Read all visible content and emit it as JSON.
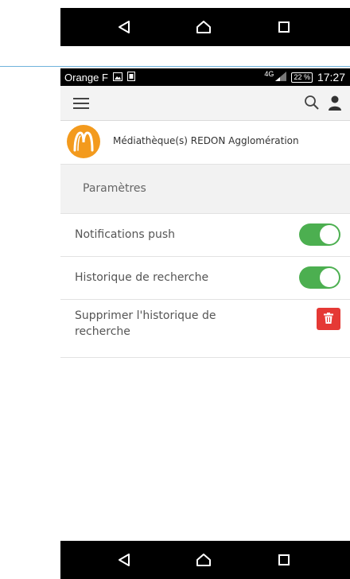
{
  "statusbar": {
    "carrier": "Orange F",
    "network": "4G",
    "battery": "22 %",
    "time": "17:27"
  },
  "library": {
    "name": "Médiathèque(s) REDON Agglomération"
  },
  "section": {
    "title": "Paramètres"
  },
  "settings": [
    {
      "label": "Notifications push",
      "enabled": true
    },
    {
      "label": "Historique de recherche",
      "enabled": true
    },
    {
      "label": "Supprimer l'historique de recherche"
    }
  ],
  "colors": {
    "toggle_on": "#4caf50",
    "delete_button": "#e53935",
    "logo": "#f39a1d"
  },
  "icons": {
    "menu": "hamburger-icon",
    "search": "search-icon",
    "account": "user-icon",
    "delete": "trash-icon",
    "nav_back": "back-triangle-icon",
    "nav_home": "home-icon",
    "nav_recents": "recents-square-icon"
  }
}
